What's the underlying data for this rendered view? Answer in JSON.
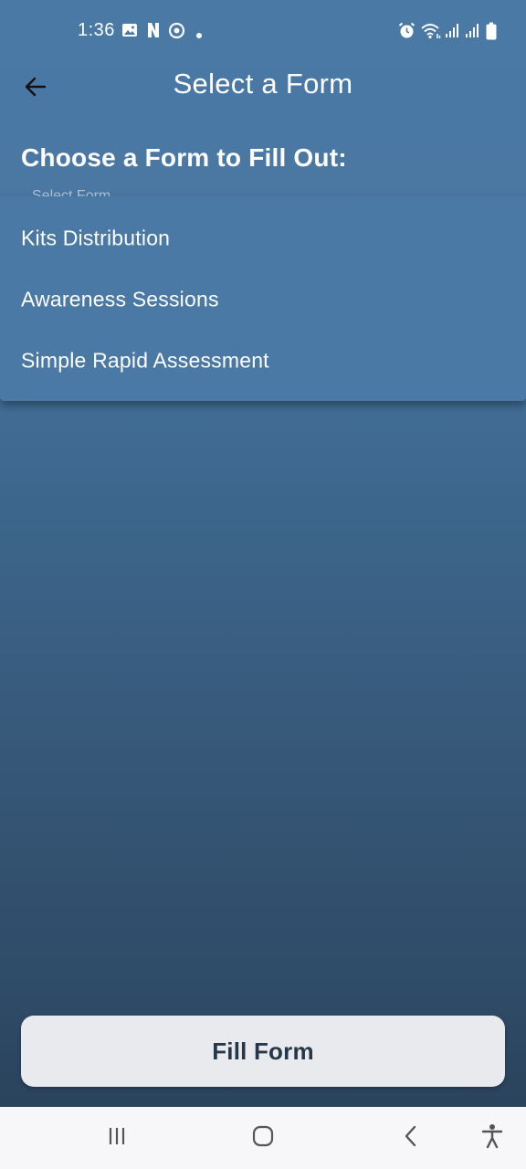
{
  "status_bar": {
    "time": "1:36",
    "left_icons": [
      "gallery-icon",
      "n-app-icon",
      "sync-circle-icon",
      "dot-icon"
    ],
    "right_icons": [
      "alarm-icon",
      "wifi-icon",
      "signal-icon",
      "signal-icon",
      "battery-icon"
    ]
  },
  "app_bar": {
    "title": "Select a Form",
    "back_icon": "arrow-back-icon"
  },
  "content": {
    "heading": "Choose a Form to Fill Out:",
    "dropdown_placeholder": "Select Form"
  },
  "dropdown": {
    "items": [
      {
        "label": "Kits Distribution"
      },
      {
        "label": "Awareness Sessions"
      },
      {
        "label": "Simple Rapid Assessment"
      }
    ]
  },
  "action": {
    "fill_form_label": "Fill Form"
  },
  "nav_bar": {
    "buttons": [
      "recents-icon",
      "home-icon",
      "back-icon",
      "accessibility-icon"
    ]
  },
  "colors": {
    "background_top": "#4a79a5",
    "background_bottom": "#2b435c",
    "menu_background": "#4a79a5",
    "button_background": "#e9eaed",
    "button_text": "#27374a",
    "nav_bar_background": "#f7f7f9"
  }
}
